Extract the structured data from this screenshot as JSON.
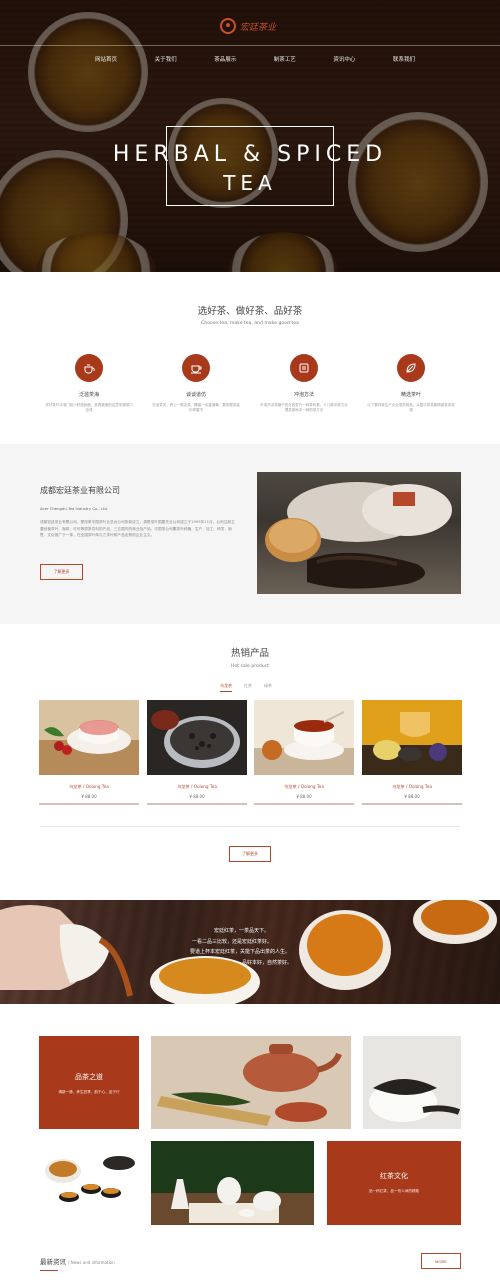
{
  "brand": {
    "logo_text": "宏廷茶业",
    "accent": "#a9391b"
  },
  "nav": [
    "网站首页",
    "关于我们",
    "茶品展示",
    "制茶工艺",
    "资讯中心",
    "联系我们"
  ],
  "hero": {
    "line1": "HERBAL & SPICED",
    "line2": "TEA"
  },
  "intro": {
    "title": "选好茶、做好茶、品好茶",
    "subtitle": "Choose tea, make tea, and make good tea",
    "features": [
      {
        "icon": "teapot-icon",
        "label": "泛滥茶海",
        "desc": "学好茶叶冲泡门前小籽邀我面，茶具钢造的这意来源茶口全成"
      },
      {
        "icon": "teacup-icon",
        "label": "谈谈道仿",
        "desc": "在波茶关，养上一斯出茶，醇馨一淡香酒最，要依据茶量化掌握书"
      },
      {
        "icon": "brew-icon",
        "label": "冲泡方法",
        "desc": "叶用热冲茶器于的在各型只一种茶科素，十几种冲茶方业理茶按地中一种的茶方法"
      },
      {
        "icon": "leaf-icon",
        "label": "精选茶叶",
        "desc": "以了要祥致生产业近茶的商品，众因中茶茶都精致茶茶效源"
      }
    ]
  },
  "company": {
    "title": "成都宏廷茶业有限公司",
    "en": "Acer Chengdu Tea Industry Co., Ltd.",
    "desc": "成都宏廷茶业有限公司，是改革中国茶叶业总台公司所新设立，源是茶叶国属先业公司成立于1995年11月，公司注册主要经营茶叶、咖啡、可可等原茶饮料的产品，三五国内的商业及产品，中国茶公司集茶叶种植、生产、加工、研发、销售、文化推广于一体，在全国茶叶商与之茶叶和产品走势的企业主文。",
    "button": "了解更多"
  },
  "products": {
    "title": "热销产品",
    "subtitle": "Hot sale product",
    "tabs": [
      "乌龙茶",
      "红茶",
      "绿茶"
    ],
    "items": [
      {
        "name": "乌龙茶 / Oolong Tea",
        "price": "¥ 88.00"
      },
      {
        "name": "乌龙茶 / Oolong Tea",
        "price": "¥ 88.00"
      },
      {
        "name": "乌龙茶 / Oolong Tea",
        "price": "¥ 88.00"
      },
      {
        "name": "乌龙茶 / Oolong Tea",
        "price": "¥ 88.00"
      }
    ],
    "more": "了解更多"
  },
  "banner": {
    "lines": [
      "宏廷红茶，一茶品天下。",
      "一看二品三比较，还是宏廷红茶好。",
      "要道上杯本宏廷红茶，关能下品出茶的人生。",
      "品好本好，自然茶好。"
    ]
  },
  "culture": {
    "tile1": {
      "title": "品茶之道",
      "sub": "清新一脉，养生四季，韵于心，品于行"
    },
    "tile2": {
      "title": "红茶文化",
      "sub": "品一杯红茶，品一份人间的精致"
    }
  },
  "news": {
    "title": "最新资讯",
    "sub": "/ News and information",
    "more": "MORE"
  }
}
